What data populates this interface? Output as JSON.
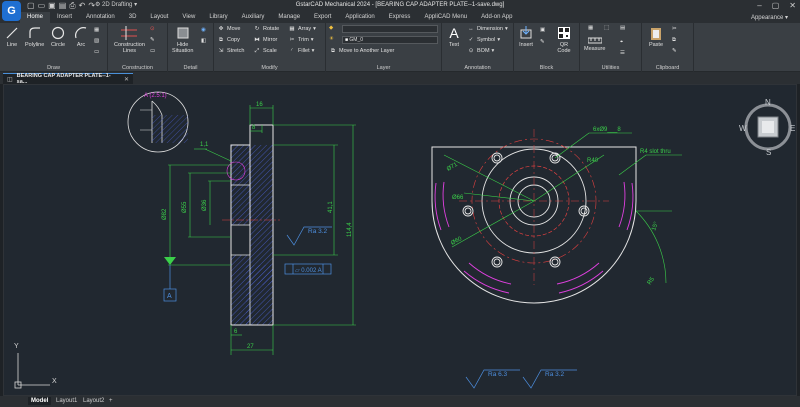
{
  "app": {
    "logo_letter": "G",
    "workspace": "2D Drafting",
    "title": "GstarCAD Mechanical 2024 - [BEARING CAP ADAPTER PLATE--1-save.dwg]",
    "appearance_label": "Appearance"
  },
  "menu": [
    "Home",
    "Insert",
    "Annotation",
    "3D",
    "Layout",
    "View",
    "Library",
    "Auxiliary",
    "Manage",
    "Export",
    "Application",
    "Express",
    "AppliCAD Menu",
    "Add-on App"
  ],
  "ribbon": {
    "draw": {
      "title": "Draw",
      "line": "Line",
      "polyline": "Polyline",
      "circle": "Circle",
      "arc": "Arc"
    },
    "construction": {
      "title": "Construction",
      "lines_l1": "Construction",
      "lines_l2": "Lines"
    },
    "detail": {
      "title": "Detail",
      "hide_l1": "Hide",
      "hide_l2": "Situation"
    },
    "modify": {
      "title": "Modify",
      "move": "Move",
      "rotate": "Rotate",
      "array": "Array",
      "copy": "Copy",
      "mirror": "Mirror",
      "trim": "Trim",
      "stretch": "Stretch",
      "scale": "Scale",
      "fillet": "Fillet"
    },
    "layer": {
      "title": "Layer",
      "current": "GM_0",
      "move_to_layer": "Move to Another Layer"
    },
    "annotation": {
      "title": "Annotation",
      "text": "Text",
      "dimension": "Dimension",
      "symbol": "Symbol",
      "bom": "BOM"
    },
    "block": {
      "title": "Block",
      "insert": "Insert",
      "qr_l1": "QR",
      "qr_l2": "Code"
    },
    "utilities": {
      "title": "Utilities",
      "measure": "Measure"
    },
    "clipboard": {
      "title": "Clipboard",
      "paste": "Paste"
    }
  },
  "document_tab": "BEARING CAP ADAPTER PLATE--1-sa...",
  "drawing": {
    "detail_label": "A (2.5:1)",
    "chamfer": "1,1",
    "dim_16": "16",
    "dim_8": "8",
    "dim_82": "Ø82",
    "dim_55": "Ø55",
    "dim_36": "Ø36",
    "dim_411": "41,1",
    "dim_1144": "114,4",
    "dim_6": "6",
    "dim_27": "27",
    "ra_side": "Ra 3.2",
    "flatness": "▱ 0.002 A",
    "datum": "A",
    "holes_note": "6xØ9___8",
    "r40": "R40",
    "r4_slot": "R4 slot thru",
    "d71": "Ø71",
    "d66": "Ø66",
    "d60": "Ø60",
    "angle_15": "15°",
    "r_56": "R5",
    "ra_bottom_1": "Ra 6.3",
    "ra_bottom_2": "Ra 3.2",
    "ucs_y": "Y",
    "ucs_x": "X"
  },
  "viewcube": {
    "n": "N",
    "s": "S",
    "e": "E",
    "w": "W"
  },
  "layout_tabs": [
    "Model",
    "Layout1",
    "Layout2",
    "+"
  ]
}
